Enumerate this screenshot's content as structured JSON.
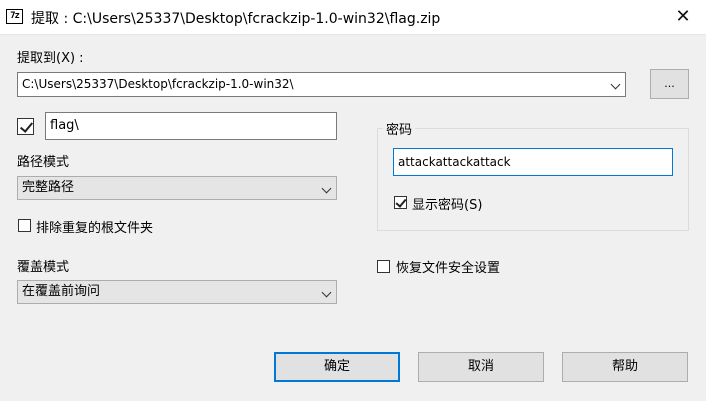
{
  "window": {
    "app_icon_text": "7z",
    "title": "提取 : C:\\Users\\25337\\Desktop\\fcrackzip-1.0-win32\\flag.zip",
    "close_glyph": "✕"
  },
  "extract_to": {
    "label": "提取到(X) :",
    "path": "C:\\Users\\25337\\Desktop\\fcrackzip-1.0-win32\\",
    "browse_label": "..."
  },
  "subfolder": {
    "checked": true,
    "value": "flag\\"
  },
  "path_mode": {
    "label": "路径模式",
    "selected": "完整路径"
  },
  "exclude_root": {
    "label": "排除重复的根文件夹",
    "checked": false
  },
  "overwrite_mode": {
    "label": "覆盖模式",
    "selected": "在覆盖前询问"
  },
  "password": {
    "group_label": "密码",
    "value": "attackattackattack",
    "show_label": "显示密码(S)",
    "show_checked": true
  },
  "restore_security": {
    "label": "恢复文件安全设置",
    "checked": false
  },
  "buttons": {
    "ok": "确定",
    "cancel": "取消",
    "help": "帮助"
  }
}
